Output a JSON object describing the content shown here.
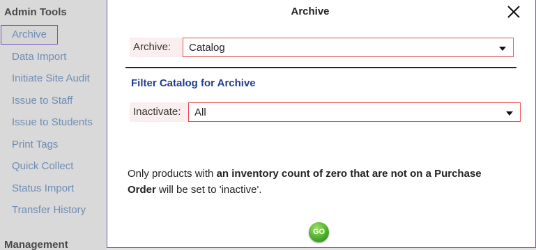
{
  "sidebar": {
    "header": "Admin Tools",
    "items": [
      {
        "label": "Archive"
      },
      {
        "label": "Data Import"
      },
      {
        "label": "Initiate Site Audit"
      },
      {
        "label": "Issue to Staff"
      },
      {
        "label": "Issue to Students"
      },
      {
        "label": "Print Tags"
      },
      {
        "label": "Quick Collect"
      },
      {
        "label": "Status Import"
      },
      {
        "label": "Transfer History"
      }
    ],
    "footer": "Management"
  },
  "modal": {
    "title": "Archive",
    "close_icon": "close-icon",
    "archive_field": {
      "label": "Archive:",
      "value": "Catalog"
    },
    "filter_heading": "Filter Catalog for Archive",
    "inactivate_field": {
      "label": "Inactivate:",
      "value": "All"
    },
    "note": {
      "part1": "Only products with ",
      "bold1": "an inventory count of zero that are not on a Purchase Order",
      "part2": " will be set to 'inactive'."
    },
    "go_label": "GO"
  },
  "colors": {
    "accent_border": "#7b59b7",
    "link": "#6f8db5",
    "field_border": "#e84b4b",
    "heading_blue": "#1f3d8f",
    "go_green": "#4fae2c"
  }
}
